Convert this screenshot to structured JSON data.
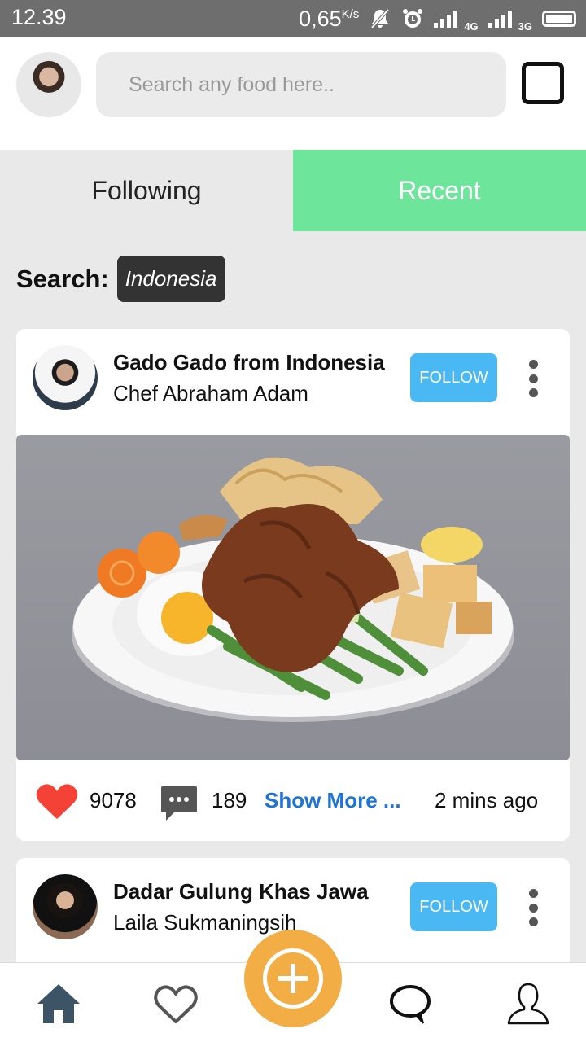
{
  "status_bar": {
    "time": "12.39",
    "speed": "0,65",
    "speed_unit": "K/s",
    "network_1": "4G",
    "network_2": "3G"
  },
  "header": {
    "search_placeholder": "Search any food here.."
  },
  "tabs": [
    {
      "label": "Following",
      "active": false
    },
    {
      "label": "Recent",
      "active": true
    }
  ],
  "search_filter": {
    "label": "Search:",
    "value": "Indonesia"
  },
  "posts": [
    {
      "title": "Gado Gado from Indonesia",
      "chef": "Chef Abraham Adam",
      "follow_label": "FOLLOW",
      "likes": "9078",
      "comments": "189",
      "show_more": "Show More ...",
      "time_ago": "2 mins ago"
    },
    {
      "title": "Dadar Gulung Khas Jawa",
      "chef": "Laila Sukmaningsih",
      "follow_label": "FOLLOW"
    }
  ],
  "colors": {
    "accent_green": "#6de69b",
    "follow_blue": "#4ab8f2",
    "fab_orange": "#f2ad45",
    "like_red": "#f44336",
    "link_blue": "#1e74d6"
  },
  "icons": [
    "avatar",
    "square-icon",
    "more-vert-icon",
    "heart-icon",
    "comment-icon",
    "home-icon",
    "heart-outline-icon",
    "add-icon",
    "chat-icon",
    "profile-icon"
  ]
}
